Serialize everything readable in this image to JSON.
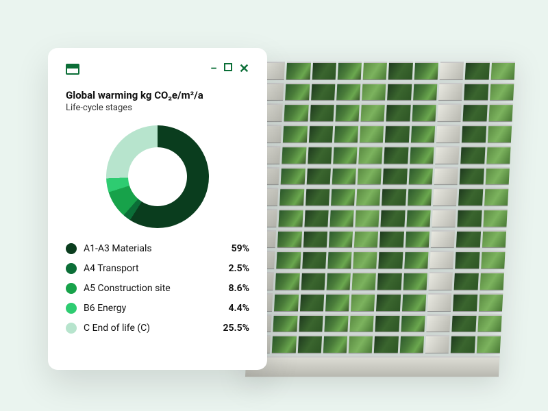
{
  "card": {
    "title": "Global warming kg CO₂e/m²/a",
    "subtitle": "Life-cycle stages"
  },
  "chart_data": {
    "type": "pie",
    "title": "Global warming kg CO₂e/m²/a",
    "subtitle": "Life-cycle stages",
    "series": [
      {
        "name": "A1-A3 Materials",
        "value": 59.0,
        "color": "#0a3d1e",
        "display": "59%"
      },
      {
        "name": "A4 Transport",
        "value": 2.5,
        "color": "#0b6e37",
        "display": "2.5%"
      },
      {
        "name": "A5 Construction site",
        "value": 8.6,
        "color": "#17a24a",
        "display": "8.6%"
      },
      {
        "name": "B6 Energy",
        "value": 4.4,
        "color": "#2ecc71",
        "display": "4.4%"
      },
      {
        "name": "C End of life (C)",
        "value": 25.5,
        "color": "#b7e4cd",
        "display": "25.5%"
      }
    ]
  },
  "building_image_alt": "Green high-rise building rendering"
}
